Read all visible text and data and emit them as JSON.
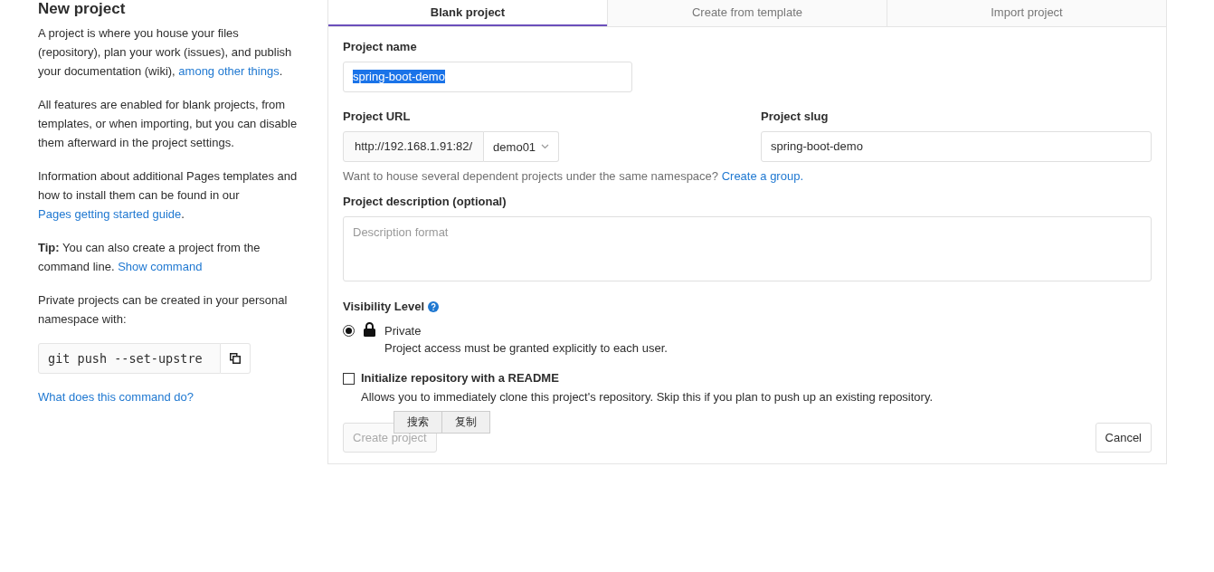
{
  "page_title": "New project",
  "intro": [
    {
      "segments": [
        {
          "kind": "text",
          "text": "A project is where you house your files (repository), plan your work (issues), and publish your documentation (wiki), "
        },
        {
          "kind": "link",
          "text": "among other things"
        },
        {
          "kind": "text",
          "text": "."
        }
      ]
    },
    {
      "segments": [
        {
          "kind": "text",
          "text": "All features are enabled for blank projects, from templates, or when importing, but you can disable them afterward in the project settings."
        }
      ]
    },
    {
      "segments": [
        {
          "kind": "text",
          "text": "Information about additional Pages templates and how to install them can be found in our "
        },
        {
          "kind": "link",
          "text": "Pages getting started guide"
        },
        {
          "kind": "text",
          "text": "."
        }
      ]
    },
    {
      "segments": [
        {
          "kind": "text",
          "text": "**Tip:** You can also create a project from the command line. "
        },
        {
          "kind": "link",
          "text": "Show command"
        }
      ]
    },
    {
      "segments": [
        {
          "kind": "text",
          "text": "Private projects can be created in your personal namespace with:"
        }
      ]
    }
  ],
  "command": {
    "text": "git push --set-upstre"
  },
  "command_help": "What does this command do?",
  "tabs": [
    {
      "label": "Blank project",
      "selected": true
    },
    {
      "label": "Create from template",
      "selected": false
    },
    {
      "label": "Import project",
      "selected": false
    }
  ],
  "form": {
    "project_name": {
      "label": "Project name",
      "value": "spring-boot-demo"
    },
    "project_url": {
      "label": "Project URL",
      "prefix": "http://192.168.1.91:82/",
      "namespace": "demo01"
    },
    "project_slug": {
      "label": "Project slug",
      "value": "spring-boot-demo"
    },
    "namespace_hint": {
      "text": "Want to house several dependent projects under the same namespace? ",
      "link": "Create a group."
    },
    "description": {
      "label": "Project description (optional)",
      "placeholder": "Description format"
    },
    "visibility": {
      "label": "Visibility Level",
      "options": [
        {
          "label": "Private",
          "description": "Project access must be granted explicitly to each user.",
          "selected": true
        }
      ]
    },
    "readme": {
      "label": "Initialize repository with a README",
      "description": "Allows you to immediately clone this project's repository. Skip this if you plan to push up an existing repository.",
      "checked": false
    },
    "create_button": {
      "label": "Create project",
      "disabled": true
    },
    "cancel_button": {
      "label": "Cancel"
    }
  },
  "context_menu": [
    "搜索",
    "复制"
  ]
}
